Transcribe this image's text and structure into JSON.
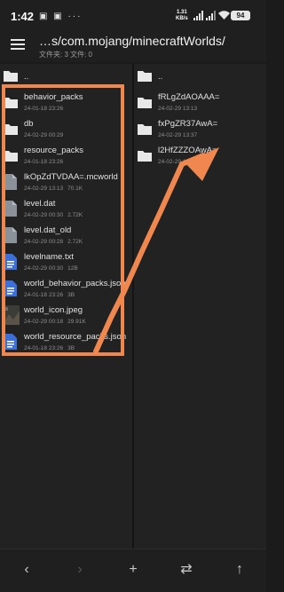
{
  "status_bar": {
    "time": "1:42",
    "notification_icons": "▣ ▣ ···",
    "speed_value": "1.31",
    "speed_unit": "KB/s",
    "battery": "94"
  },
  "app_bar": {
    "menu_icon": "hamburger-menu-icon",
    "path": "…s/com.mojang/minecraftWorlds/",
    "summary": "文件夹: 3  文件: 0"
  },
  "left_pane": {
    "parent_label": "..",
    "items": [
      {
        "name": "behavior_packs",
        "date": "24-01-18 23:26",
        "size": "",
        "icon": "folder-icon"
      },
      {
        "name": "db",
        "date": "24-02-29 00:29",
        "size": "",
        "icon": "folder-icon"
      },
      {
        "name": "resource_packs",
        "date": "24-01-18 23:26",
        "size": "",
        "icon": "folder-icon"
      },
      {
        "name": "lkOpZdTVDAA=.mcworld",
        "date": "24-02-29 13:13",
        "size": "70.1K",
        "icon": "file-icon"
      },
      {
        "name": "level.dat",
        "date": "24-02-29 00:30",
        "size": "2.72K",
        "icon": "file-icon"
      },
      {
        "name": "level.dat_old",
        "date": "24-02-29 00:28",
        "size": "2.72K",
        "icon": "file-icon"
      },
      {
        "name": "levelname.txt",
        "date": "24-02-29 00:30",
        "size": "12B",
        "icon": "text-file-icon"
      },
      {
        "name": "world_behavior_packs.json",
        "date": "24-01-18 23:26",
        "size": "3B",
        "icon": "text-file-icon"
      },
      {
        "name": "world_icon.jpeg",
        "date": "24-02-29 00:18",
        "size": "29.91K",
        "icon": "image-thumbnail-icon"
      },
      {
        "name": "world_resource_packs.json",
        "date": "24-01-18 23:26",
        "size": "3B",
        "icon": "text-file-icon"
      }
    ]
  },
  "right_pane": {
    "parent_label": "..",
    "items": [
      {
        "name": "fRLgZdAOAAA=",
        "date": "24-02-29 13:13",
        "icon": "folder-icon"
      },
      {
        "name": "fxPgZR37AwA=",
        "date": "24-02-29 13:37",
        "icon": "folder-icon"
      },
      {
        "name": "l2HfZZZOAwA=",
        "date": "24-02-29 12:17",
        "icon": "folder-icon"
      }
    ]
  },
  "toolbar": {
    "back": "‹",
    "forward": "›",
    "add": "+",
    "swap": "⇄",
    "up": "↑"
  },
  "annotation": {
    "color": "#f0874f"
  },
  "colors": {
    "background": "#222222",
    "folder": "#e8e8e8",
    "file": "#8a9199",
    "text_file": "#3d6fd9"
  }
}
